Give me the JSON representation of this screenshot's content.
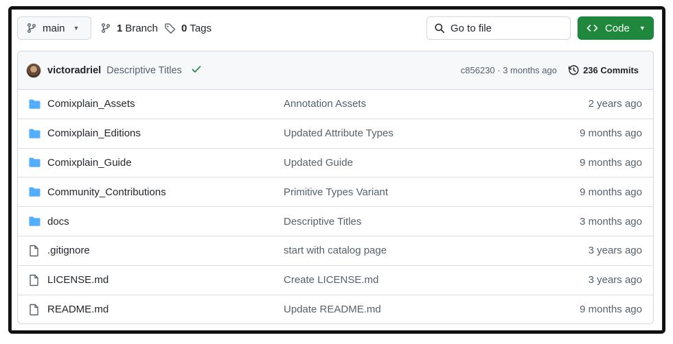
{
  "toolbar": {
    "branch_name": "main",
    "branch_count": "1",
    "branch_label": "Branch",
    "tag_count": "0",
    "tag_label": "Tags",
    "goto_placeholder": "Go to file",
    "code_label": "Code"
  },
  "latest_commit": {
    "author": "victoradriel",
    "message": "Descriptive Titles",
    "hash_time": "c856230 · 3 months ago",
    "commits_label": "236 Commits"
  },
  "files": [
    {
      "type": "folder",
      "name": "Comixplain_Assets",
      "message": "Annotation Assets",
      "age": "2 years ago"
    },
    {
      "type": "folder",
      "name": "Comixplain_Editions",
      "message": "Updated Attribute Types",
      "age": "9 months ago"
    },
    {
      "type": "folder",
      "name": "Comixplain_Guide",
      "message": "Updated Guide",
      "age": "9 months ago"
    },
    {
      "type": "folder",
      "name": "Community_Contributions",
      "message": "Primitive Types Variant",
      "age": "9 months ago"
    },
    {
      "type": "folder",
      "name": "docs",
      "message": "Descriptive Titles",
      "age": "3 months ago"
    },
    {
      "type": "file",
      "name": ".gitignore",
      "message": "start with catalog page",
      "age": "3 years ago"
    },
    {
      "type": "file",
      "name": "LICENSE.md",
      "message": "Create LICENSE.md",
      "age": "3 years ago"
    },
    {
      "type": "file",
      "name": "README.md",
      "message": "Update README.md",
      "age": "9 months ago"
    }
  ],
  "colors": {
    "folder": "#54aeff",
    "code_button": "#1f883d",
    "check": "#1a7f37"
  }
}
